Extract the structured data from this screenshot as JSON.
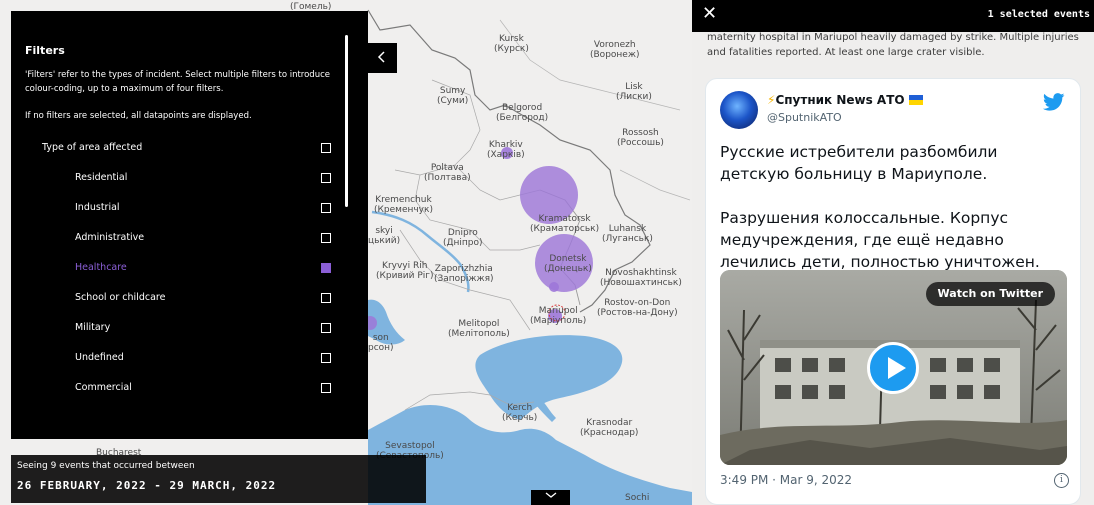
{
  "colors": {
    "panel_bg": "#000000",
    "accent_purple": "#8b5fd6",
    "bubble_purple": "#9d77d8",
    "sea": "#7fb4df",
    "land": "#f0efee",
    "twitter_blue": "#1d9bf0"
  },
  "filters": {
    "title": "Filters",
    "description": "'Filters' refer to the types of incident. Select multiple filters to introduce colour-coding, up to a maximum of four filters.",
    "note": "If no filters are selected, all datapoints are displayed.",
    "collapse_icon": "chevron-left-icon",
    "items": [
      {
        "label": "Type of area affected",
        "checked": false
      },
      {
        "label": "Residential",
        "checked": false
      },
      {
        "label": "Industrial",
        "checked": false
      },
      {
        "label": "Administrative",
        "checked": false
      },
      {
        "label": "Healthcare",
        "checked": true
      },
      {
        "label": "School or childcare",
        "checked": false
      },
      {
        "label": "Military",
        "checked": false
      },
      {
        "label": "Undefined",
        "checked": false
      },
      {
        "label": "Commercial",
        "checked": false
      }
    ]
  },
  "events_bar": {
    "summary": "Seeing 9 events that occurred between",
    "date_range": "26 FEBRUARY, 2022 - 29 MARCH, 2022",
    "expand_icon": "chevron-down-icon"
  },
  "map": {
    "cities": [
      {
        "name": "Kursk",
        "local": "(Курск)"
      },
      {
        "name": "Voronezh",
        "local": "(Воронеж)"
      },
      {
        "name": "Sumy",
        "local": "(Суми)"
      },
      {
        "name": "Lisk",
        "local": "(Лиски)"
      },
      {
        "name": "Belgorod",
        "local": "(Белгород)"
      },
      {
        "name": "Rossosh",
        "local": "(Россошь)"
      },
      {
        "name": "Kharkiv",
        "local": "(Харків)"
      },
      {
        "name": "Poltava",
        "local": "(Полтава)"
      },
      {
        "name": "Kremenchuk",
        "local": "(Кременчук)"
      },
      {
        "name": "Kramatorsk",
        "local": "(Краматорськ)"
      },
      {
        "name": "Luhansk",
        "local": "(Луганськ)"
      },
      {
        "name": "Dnipro",
        "local": "(Дніпро)"
      },
      {
        "name": "Donetsk",
        "local": "(Донецьк)"
      },
      {
        "name": "Kryvyi Rih",
        "local": "(Кривий Ріг)"
      },
      {
        "name": "Zaporizhzhia",
        "local": "(Запоріжжя)"
      },
      {
        "name": "Novoshakhtinsk",
        "local": "(Новошахтинськ)"
      },
      {
        "name": "Rostov-on-Don",
        "local": "(Ростов-на-Дону)"
      },
      {
        "name": "Melitopol",
        "local": "(Мелітополь)"
      },
      {
        "name": "Mariupol",
        "local": "(Маріуполь)"
      },
      {
        "name": "Kerch",
        "local": "(Керчь)"
      },
      {
        "name": "Krasnodar",
        "local": "(Краснодар)"
      },
      {
        "name": "Sevastopol",
        "local": "(Севастополь)"
      },
      {
        "name": "Sochi",
        "local": ""
      },
      {
        "name": "Bucharest",
        "local": ""
      },
      {
        "name": "(Гомель)",
        "local": ""
      },
      {
        "name": "skyi",
        "local": "цький)"
      },
      {
        "name": "son",
        "local": "рсон)"
      }
    ]
  },
  "selected_panel": {
    "close_icon": "close-icon",
    "count": "1 selected events",
    "description": "maternity hospital in Mariupol heavily damaged by strike. Multiple injuries and fatalities reported. At least one large crater visible."
  },
  "tweet": {
    "display_name": "Спутник News АТО",
    "name_prefix_icon": "lightning-icon",
    "name_suffix_icon": "ukraine-flag-icon",
    "handle": "@SputnikATO",
    "text_paragraph_1": "Русские истребители разбомбили детскую больницу в Мариуполе.",
    "text_paragraph_2": "Разрушения колоссальные. Корпус медучреждения, где ещё недавно лечились дети, полностью уничтожен.",
    "watch_label": "Watch on Twitter",
    "timestamp": "3:49 PM · Mar 9, 2022",
    "info_icon": "info-icon",
    "brand_icon": "twitter-bird-icon",
    "media_icon": "play-icon"
  }
}
